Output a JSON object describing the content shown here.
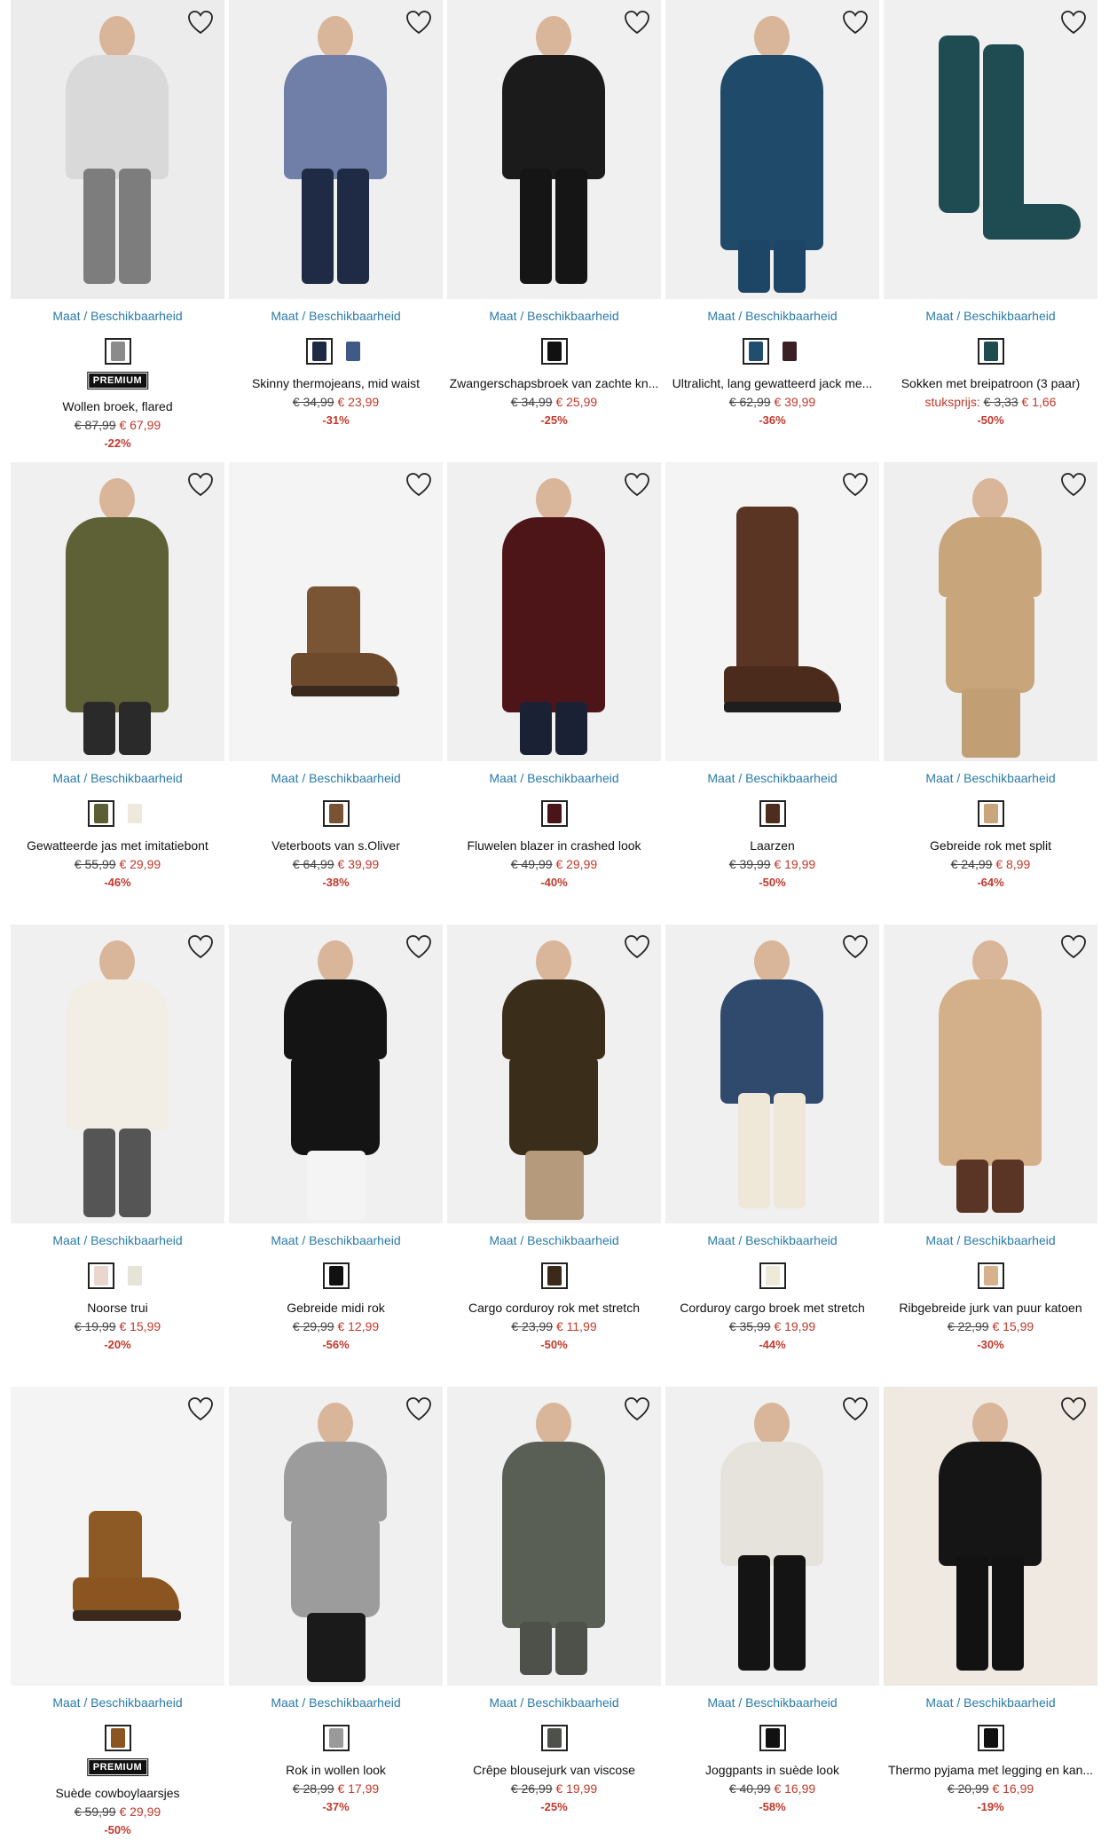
{
  "size_link_label": "Maat / Beschikbaarheid",
  "premium_label": "PREMIUM",
  "products": [
    {
      "name": "Wollen broek, flared",
      "old_price": "€ 87,99",
      "new_price": "€ 67,99",
      "discount": "-22%",
      "premium": true,
      "swatches": [
        "#8b8b8b"
      ],
      "photo": {
        "bg": "#ececec",
        "top": "#d9d9d9",
        "bottom": "#7d7d7d",
        "kind": "legs"
      }
    },
    {
      "name": "Skinny thermojeans, mid waist",
      "old_price": "€ 34,99",
      "new_price": "€ 23,99",
      "discount": "-31%",
      "premium": false,
      "swatches": [
        "#1e2a44",
        "#3f5a86"
      ],
      "photo": {
        "bg": "#efefef",
        "top": "#6f7fa8",
        "bottom": "#1f2a44",
        "kind": "legs"
      }
    },
    {
      "name": "Zwangerschapsbroek van zachte kn...",
      "old_price": "€ 34,99",
      "new_price": "€ 25,99",
      "discount": "-25%",
      "premium": false,
      "swatches": [
        "#111111"
      ],
      "photo": {
        "bg": "#f0f0f0",
        "top": "#1b1b1b",
        "bottom": "#151515",
        "kind": "legs"
      }
    },
    {
      "name": "Ultralicht, lang gewatteerd jack me...",
      "old_price": "€ 62,99",
      "new_price": "€ 39,99",
      "discount": "-36%",
      "premium": false,
      "swatches": [
        "#1f4e6e",
        "#3a1f24"
      ],
      "photo": {
        "bg": "#f0f0f0",
        "top": "#1f4a6a",
        "bottom": "#1c4566",
        "kind": "coat"
      }
    },
    {
      "name": "Sokken met breipatroon (3 paar)",
      "unit_label": "stuksprijs:",
      "old_price": "€ 3,33",
      "new_price": "€ 1,66",
      "discount": "-50%",
      "premium": false,
      "swatches": [
        "#1f4b4e"
      ],
      "photo": {
        "bg": "#f0f0f0",
        "top": "#1f4b52",
        "bottom": "#1f4b52",
        "kind": "sock"
      }
    },
    {
      "name": "Gewatteerde jas met imitatiebont",
      "old_price": "€ 55,99",
      "new_price": "€ 29,99",
      "discount": "-46%",
      "premium": false,
      "swatches": [
        "#5b5f34",
        "#efe8dc"
      ],
      "photo": {
        "bg": "#f0f0f0",
        "top": "#5e6135",
        "bottom": "#2a2a2a",
        "kind": "coat"
      }
    },
    {
      "name": "Veterboots van s.Oliver",
      "old_price": "€ 64,99",
      "new_price": "€ 39,99",
      "discount": "-38%",
      "premium": false,
      "swatches": [
        "#7a5234"
      ],
      "photo": {
        "bg": "#f4f4f4",
        "top": "#7a5535",
        "bottom": "#6e4a2c",
        "kind": "boot"
      }
    },
    {
      "name": "Fluwelen blazer in crashed look",
      "old_price": "€ 49,99",
      "new_price": "€ 29,99",
      "discount": "-40%",
      "premium": false,
      "swatches": [
        "#4a1418"
      ],
      "photo": {
        "bg": "#f0f0f0",
        "top": "#4e1518",
        "bottom": "#1b2135",
        "kind": "coat"
      }
    },
    {
      "name": "Laarzen",
      "old_price": "€ 39,99",
      "new_price": "€ 19,99",
      "discount": "-50%",
      "premium": false,
      "swatches": [
        "#4e2d1f"
      ],
      "photo": {
        "bg": "#f4f4f4",
        "top": "#5a3524",
        "bottom": "#4a2b1c",
        "kind": "tallboot"
      }
    },
    {
      "name": "Gebreide rok met split",
      "old_price": "€ 24,99",
      "new_price": "€ 8,99",
      "discount": "-64%",
      "premium": false,
      "swatches": [
        "#c9a57c"
      ],
      "photo": {
        "bg": "#efefef",
        "top": "#c9a57c",
        "bottom": "#c29e74",
        "kind": "skirt"
      }
    },
    {
      "name": "Noorse trui",
      "old_price": "€ 19,99",
      "new_price": "€ 15,99",
      "discount": "-20%",
      "premium": false,
      "swatches": [
        "#e8d6cf",
        "#e6e4d6"
      ],
      "photo": {
        "bg": "#f0f0f0",
        "top": "#f2eee6",
        "bottom": "#555555",
        "kind": "sweater"
      }
    },
    {
      "name": "Gebreide midi rok",
      "old_price": "€ 29,99",
      "new_price": "€ 12,99",
      "discount": "-56%",
      "premium": false,
      "swatches": [
        "#111111"
      ],
      "photo": {
        "bg": "#f0f0f0",
        "top": "#141414",
        "bottom": "#f4f4f4",
        "kind": "skirt"
      }
    },
    {
      "name": "Cargo corduroy rok met stretch",
      "old_price": "€ 23,99",
      "new_price": "€ 11,99",
      "discount": "-50%",
      "premium": false,
      "swatches": [
        "#3b2a1a"
      ],
      "photo": {
        "bg": "#f0f0f0",
        "top": "#3a2d1a",
        "bottom": "#b59a7b",
        "kind": "skirt"
      }
    },
    {
      "name": "Corduroy cargo broek met stretch",
      "old_price": "€ 35,99",
      "new_price": "€ 19,99",
      "discount": "-44%",
      "premium": false,
      "swatches": [
        "#efe9da"
      ],
      "photo": {
        "bg": "#f0f0f0",
        "top": "#2f4a6c",
        "bottom": "#efe8d8",
        "kind": "legs"
      }
    },
    {
      "name": "Ribgebreide jurk van puur katoen",
      "old_price": "€ 22,99",
      "new_price": "€ 15,99",
      "discount": "-30%",
      "premium": false,
      "swatches": [
        "#d5b28c"
      ],
      "photo": {
        "bg": "#f0f0f0",
        "top": "#d4b08a",
        "bottom": "#5a3424",
        "kind": "dress"
      }
    },
    {
      "name": "Suède cowboylaarsjes",
      "old_price": "€ 59,99",
      "new_price": "€ 29,99",
      "discount": "-50%",
      "premium": true,
      "swatches": [
        "#8a5521"
      ],
      "photo": {
        "bg": "#f4f4f4",
        "top": "#8d5a25",
        "bottom": "#8a5521",
        "kind": "boot"
      }
    },
    {
      "name": "Rok in wollen look",
      "old_price": "€ 28,99",
      "new_price": "€ 17,99",
      "discount": "-37%",
      "premium": false,
      "swatches": [
        "#9a9a9a"
      ],
      "photo": {
        "bg": "#f0f0f0",
        "top": "#9c9c9c",
        "bottom": "#1a1a1a",
        "kind": "skirt"
      }
    },
    {
      "name": "Crêpe blousejurk van viscose",
      "old_price": "€ 26,99",
      "new_price": "€ 19,99",
      "discount": "-25%",
      "premium": false,
      "swatches": [
        "#4d5149"
      ],
      "photo": {
        "bg": "#f0f0f0",
        "top": "#5a5f55",
        "bottom": "#4d5149",
        "kind": "dress"
      }
    },
    {
      "name": "Joggpants in suède look",
      "old_price": "€ 40,99",
      "new_price": "€ 16,99",
      "discount": "-58%",
      "premium": false,
      "swatches": [
        "#111111"
      ],
      "photo": {
        "bg": "#f0f0f0",
        "top": "#e6e2dc",
        "bottom": "#141414",
        "kind": "legs"
      }
    },
    {
      "name": "Thermo pyjama met legging en kan...",
      "old_price": "€ 20,99",
      "new_price": "€ 16,99",
      "discount": "-19%",
      "premium": false,
      "swatches": [
        "#111111"
      ],
      "photo": {
        "bg": "#efe9e2",
        "top": "#151515",
        "bottom": "#121212",
        "kind": "legs"
      }
    }
  ]
}
